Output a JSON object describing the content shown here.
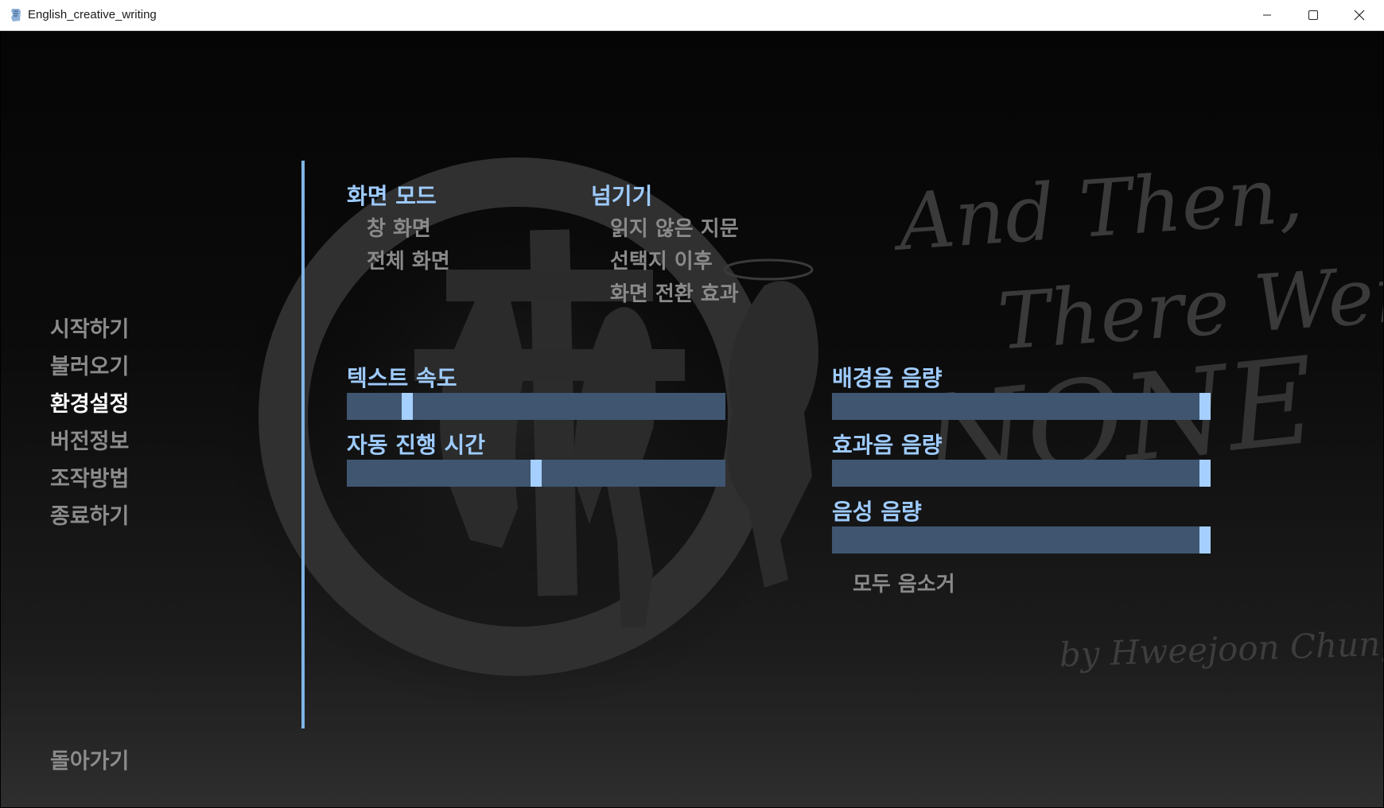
{
  "window": {
    "title": "English_creative_writing"
  },
  "menu": {
    "items": [
      {
        "label": "시작하기"
      },
      {
        "label": "불러오기"
      },
      {
        "label": "환경설정"
      },
      {
        "label": "버전정보"
      },
      {
        "label": "조작방법"
      },
      {
        "label": "종료하기"
      }
    ],
    "selected": "환경설정",
    "back_label": "돌아가기"
  },
  "display_mode": {
    "heading": "화면 모드",
    "options": [
      "창 화면",
      "전체 화면"
    ]
  },
  "skip": {
    "heading": "넘기기",
    "options": [
      "읽지 않은 지문",
      "선택지 이후",
      "화면 전환 효과"
    ]
  },
  "sliders": {
    "text_speed": {
      "label": "텍스트 속도",
      "value": 0.15
    },
    "auto_forward_time": {
      "label": "자동 진행 시간",
      "value": 0.5
    },
    "music_volume": {
      "label": "배경음 음량",
      "value": 1.0
    },
    "sound_volume": {
      "label": "효과음 음량",
      "value": 1.0
    },
    "voice_volume": {
      "label": "음성 음량",
      "value": 1.0
    }
  },
  "mute_all_label": "모두 음소거",
  "background_title": {
    "line1": "And Then,",
    "line2": "There Were",
    "line3": "NONE",
    "byline": "by Hweejoon Chung"
  },
  "colors": {
    "accent": "#9ecbff",
    "slider_track": "#3f5570",
    "slider_thumb": "#a5cfff",
    "divider": "#7fb5e8",
    "selected_menu": "#ffffff",
    "idle_text": "#8c8c8c"
  }
}
